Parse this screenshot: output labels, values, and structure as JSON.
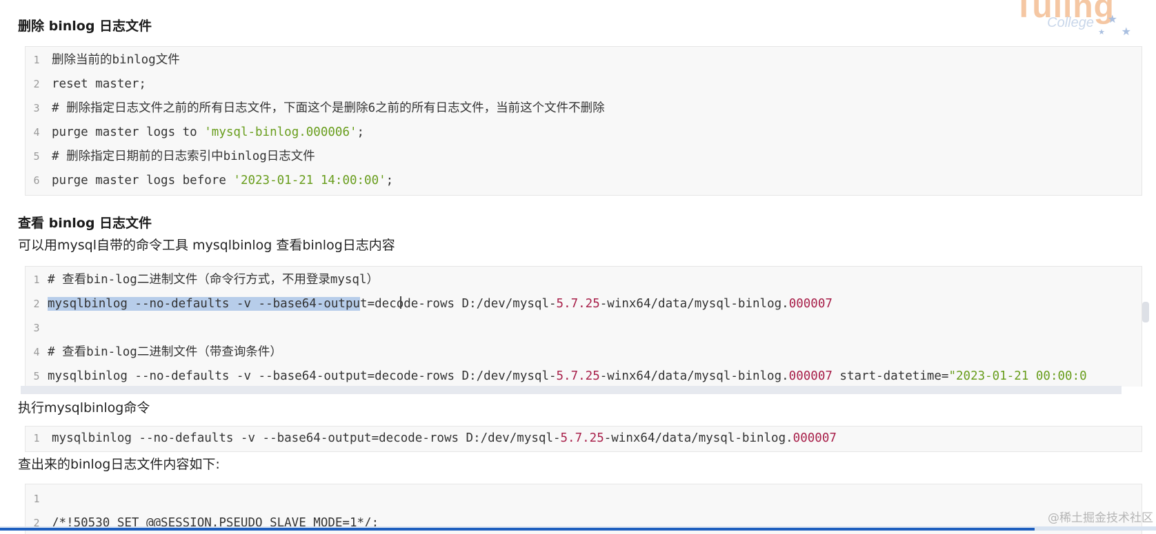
{
  "sections": {
    "delete_title": "删除 binlog 日志文件",
    "view_title": "查看 binlog 日志文件",
    "view_desc": "可以用mysql自带的命令工具 mysqlbinlog 查看binlog日志内容",
    "exec_desc": "执行mysqlbinlog命令",
    "result_desc": "查出来的binlog日志文件内容如下:"
  },
  "code_delete": {
    "lines": [
      {
        "no": "1",
        "a": "删除当前的binlog文件"
      },
      {
        "no": "2",
        "a": "reset master;"
      },
      {
        "no": "3",
        "a": "# 删除指定日志文件之前的所有日志文件，下面这个是删除6之前的所有日志文件，当前这个文件不删除"
      },
      {
        "no": "4",
        "a": "purge master logs to ",
        "str": "'mysql-binlog.000006'",
        "b": ";"
      },
      {
        "no": "5",
        "a": "# 删除指定日期前的日志索引中binlog日志文件"
      },
      {
        "no": "6",
        "a": "purge master logs before ",
        "str": "'2023-01-21 14:00:00'",
        "b": ";"
      }
    ]
  },
  "code_view": {
    "lines": [
      {
        "no": "1",
        "a": "# 查看bin-log二进制文件（命令行方式，不用登录mysql）"
      },
      {
        "no": "2",
        "hl": "mysqlbinlog --no-defaults -v --base64-outpu",
        "a": "t=decode-rows D:/dev/mysql-",
        "n1": "5.7.25",
        "b": "-winx64/data/mysql-binlog.",
        "n2": "000007"
      },
      {
        "no": "3",
        "a": ""
      },
      {
        "no": "4",
        "a": "# 查看bin-log二进制文件（带查询条件）"
      },
      {
        "no": "5",
        "a": "mysqlbinlog --no-defaults -v --base64-output=decode-rows D:/dev/mysql-",
        "n1": "5.7.25",
        "b": "-winx64/data/mysql-binlog.",
        "n2": "000007",
        "c": " start-datetime=",
        "str": "\"2023-01-21 00:00:0"
      }
    ]
  },
  "code_exec": {
    "lines": [
      {
        "no": "1",
        "a": "mysqlbinlog --no-defaults -v --base64-output=decode-rows D:/dev/mysql-",
        "n1": "5.7.25",
        "b": "-winx64/data/mysql-binlog.",
        "n2": "000007"
      }
    ]
  },
  "code_result": {
    "lines": [
      {
        "no": "1",
        "a": ""
      },
      {
        "no": "2",
        "a": "/*!50530 SET @@SESSION.PSEUDO_SLAVE_MODE=1*/;"
      }
    ]
  },
  "logo": {
    "word": "Tuling",
    "sub": "College"
  },
  "watermark": "@稀土掘金技术社区",
  "colors": {
    "string": "#689d1c",
    "number": "#a8204a",
    "selection": "#b7cdea"
  }
}
